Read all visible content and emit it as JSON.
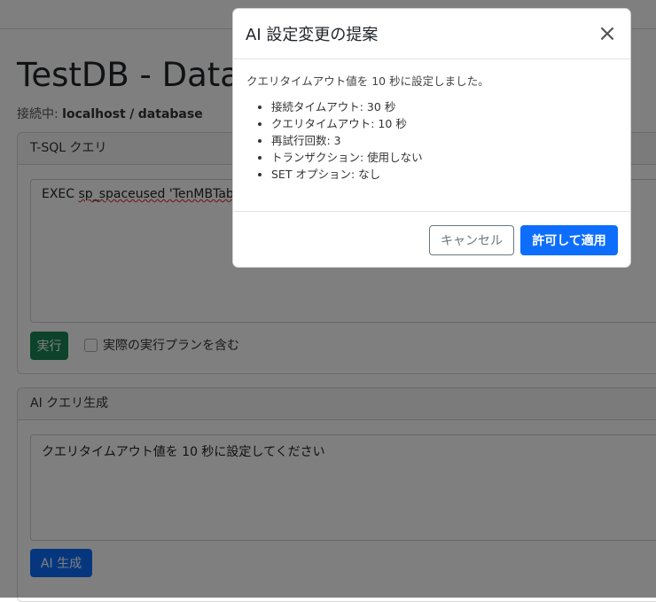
{
  "page": {
    "title": "TestDB - Database",
    "connection_label": "接続中:",
    "connection_host": "localhost",
    "connection_sep": "/",
    "connection_db": "database"
  },
  "sql_card": {
    "header": "T-SQL クエリ",
    "query_prefix": "EXEC ",
    "query_sp": "sp_spaceused",
    "query_rest": " 'TenMBTable'",
    "run_button": "実行",
    "include_plan_label": "実際の実行プランを含む",
    "include_plan_checked": false
  },
  "ai_card": {
    "header": "AI クエリ生成",
    "prompt": "クエリタイムアウト値を 10 秒に設定してください",
    "generate_button": "AI 生成"
  },
  "modal": {
    "title": "AI 設定変更の提案",
    "close_icon": "close-icon",
    "intro": "クエリタイムアウト値を 10 秒に設定しました。",
    "items": [
      "接続タイムアウト: 30 秒",
      "クエリタイムアウト: 10 秒",
      "再試行回数: 3",
      "トランザクション: 使用しない",
      "SET オプション: なし"
    ],
    "cancel_button": "キャンセル",
    "apply_button": "許可して適用"
  },
  "colors": {
    "primary": "#0d6efd",
    "success": "#198754",
    "backdrop": "rgba(0,0,0,0.5)"
  }
}
